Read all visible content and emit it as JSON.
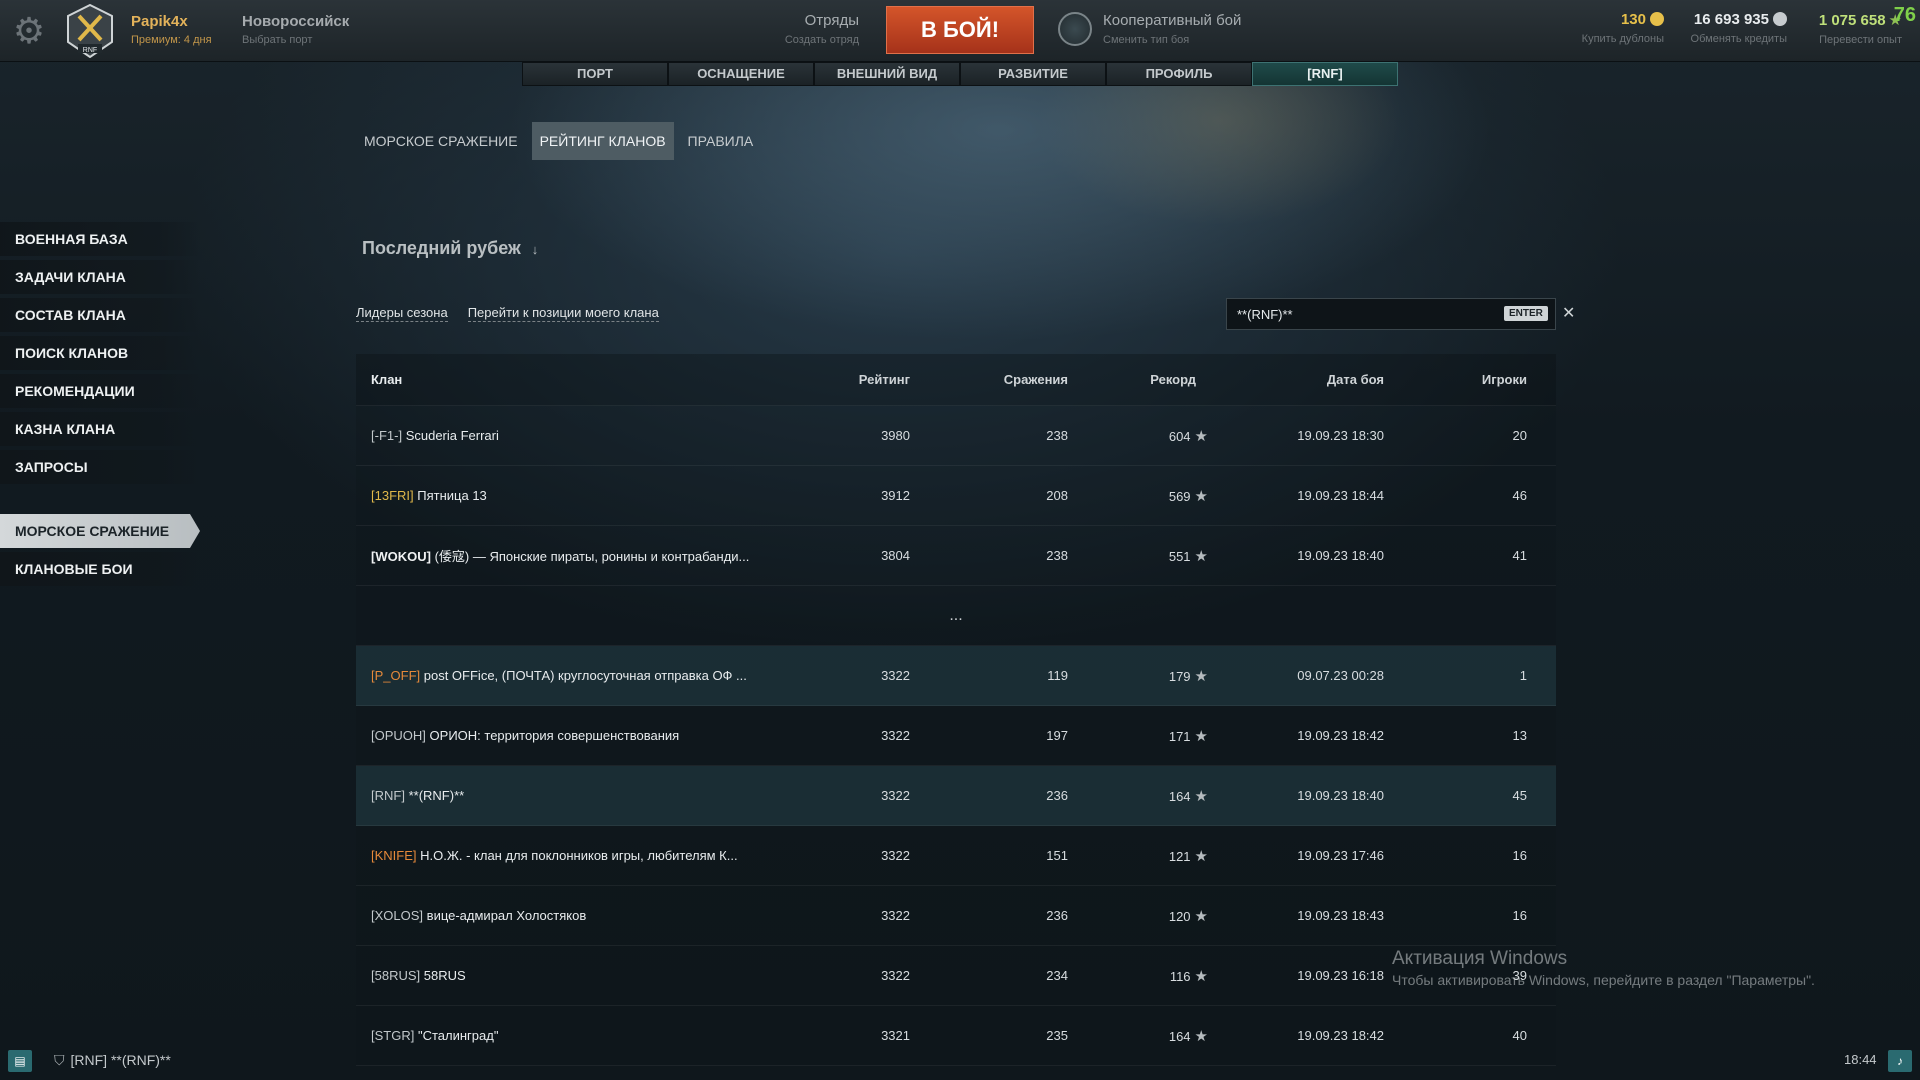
{
  "topbar": {
    "player_name": "Papik4x",
    "premium": "Премиум: 4 дня",
    "port_name": "Новороссийск",
    "port_sub": "Выбрать порт",
    "squads_title": "Отряды",
    "squads_sub": "Создать отряд",
    "battle_label": "В БОЙ!",
    "mode_title": "Кооперативный бой",
    "mode_sub": "Сменить тип боя",
    "doubloons": "130",
    "doubloons_sub": "Купить дублоны",
    "credits": "16 693 935",
    "credits_sub": "Обменять кредиты",
    "xp": "1 075 658",
    "xp_sub": "Перевести опыт",
    "badge": "76",
    "emblem_tag": "RNF"
  },
  "main_tabs": [
    "ПОРТ",
    "ОСНАЩЕНИЕ",
    "ВНЕШНИЙ ВИД",
    "РАЗВИТИЕ",
    "ПРОФИЛЬ",
    "[RNF]"
  ],
  "sub_tabs": [
    "МОРСКОЕ СРАЖЕНИЕ",
    "РЕЙТИНГ КЛАНОВ",
    "ПРАВИЛА"
  ],
  "left_menu": [
    "ВОЕННАЯ БАЗА",
    "ЗАДАЧИ КЛАНА",
    "СОСТАВ КЛАНА",
    "ПОИСК КЛАНОВ",
    "РЕКОМЕНДАЦИИ",
    "КАЗНА КЛАНА",
    "ЗАПРОСЫ"
  ],
  "left_menu_2": [
    "МОРСКОЕ СРАЖЕНИЕ",
    "КЛАНОВЫЕ БОИ"
  ],
  "season_title": "Последний рубеж",
  "links": {
    "leaders": "Лидеры сезона",
    "my_clan": "Перейти к позиции моего клана"
  },
  "search": {
    "value": "**(RNF)**",
    "enter": "ENTER",
    "clear": "✕"
  },
  "table": {
    "headers": {
      "clan": "Клан",
      "rating": "Рейтинг",
      "battles": "Сражения",
      "record": "Рекорд",
      "date": "Дата боя",
      "players": "Игроки"
    },
    "ellipsis": "...",
    "top_rows": [
      {
        "tag": "[-F1-]",
        "name": "Scuderia Ferrari",
        "rating": "3980",
        "battles": "238",
        "record": "604",
        "date": "19.09.23 18:30",
        "players": "20"
      },
      {
        "tag": "[13FRI]",
        "name": "Пятница 13",
        "rating": "3912",
        "battles": "208",
        "record": "569",
        "date": "19.09.23 18:44",
        "players": "46"
      },
      {
        "tag": "[WOKOU]",
        "name": "(倭寇) — Японские пираты, ронины и контрабанди...",
        "rating": "3804",
        "battles": "238",
        "record": "551",
        "date": "19.09.23 18:40",
        "players": "41"
      }
    ],
    "rows": [
      {
        "tag": "[P_OFF]",
        "name": "post OFFice, (ПОЧТА) круглосуточная отправка ОФ ...",
        "rating": "3322",
        "battles": "119",
        "record": "179",
        "date": "09.07.23 00:28",
        "players": "1"
      },
      {
        "tag": "[OPUOH]",
        "name": "ОРИОН: территория совершенствования",
        "rating": "3322",
        "battles": "197",
        "record": "171",
        "date": "19.09.23 18:42",
        "players": "13"
      },
      {
        "tag": "[RNF]",
        "name": "**(RNF)**",
        "rating": "3322",
        "battles": "236",
        "record": "164",
        "date": "19.09.23 18:40",
        "players": "45"
      },
      {
        "tag": "[KNIFE]",
        "name": "Н.О.Ж. - клан для поклонников игры, любителям К...",
        "rating": "3322",
        "battles": "151",
        "record": "121",
        "date": "19.09.23 17:46",
        "players": "16"
      },
      {
        "tag": "[XOLOS]",
        "name": "вице-адмирал Холостяков",
        "rating": "3322",
        "battles": "236",
        "record": "120",
        "date": "19.09.23 18:43",
        "players": "16"
      },
      {
        "tag": "[58RUS]",
        "name": "58RUS",
        "rating": "3322",
        "battles": "234",
        "record": "116",
        "date": "19.09.23 16:18",
        "players": "39"
      },
      {
        "tag": "[STGR]",
        "name": "\"Сталинград\"",
        "rating": "3321",
        "battles": "235",
        "record": "164",
        "date": "19.09.23 18:42",
        "players": "40"
      }
    ]
  },
  "watermark": {
    "title": "Активация Windows",
    "sub": "Чтобы активировать Windows, перейдите в раздел \"Параметры\"."
  },
  "bottom": {
    "clan": "[RNF] **(RNF)**",
    "clock": "18:44"
  },
  "colors": {
    "accent_tab": "#1f4a4a",
    "battle": "#c4431f",
    "gold": "#e0b84a",
    "orange": "#e5893a"
  },
  "icons": [
    "gear-icon",
    "clan-emblem-icon",
    "mode-icon",
    "doubloon-icon",
    "credit-icon",
    "xp-star-icon",
    "star-icon",
    "chat-icon",
    "shield-icon",
    "bell-icon"
  ]
}
